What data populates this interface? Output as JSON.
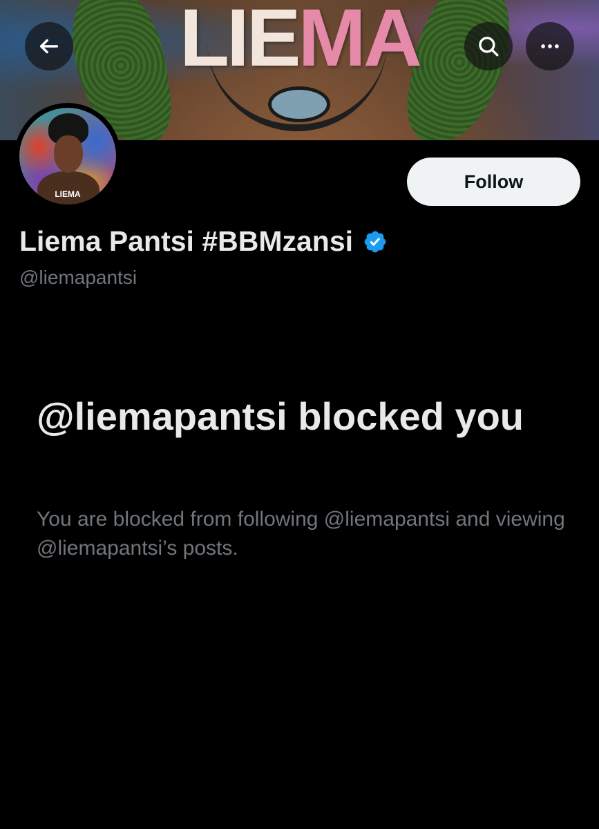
{
  "banner": {
    "brand_part1": "LIE",
    "brand_part2": "MA"
  },
  "header": {
    "back_icon": "arrow-left-icon",
    "search_icon": "search-icon",
    "more_icon": "more-horizontal-icon"
  },
  "profile": {
    "avatar_label": "LIEMA",
    "follow_label": "Follow",
    "display_name": "Liema Pantsi #BBMzansi",
    "verified_color": "#1d9bf0",
    "handle": "@liemapantsi"
  },
  "blocked": {
    "title": "@liemapantsi blocked you",
    "description": "You are blocked from following @liemapantsi and viewing @liemapantsi’s posts."
  },
  "colors": {
    "background": "#000000",
    "primary_text": "#e7e9ea",
    "secondary_text": "#71767b",
    "follow_bg": "#eff3f4"
  }
}
